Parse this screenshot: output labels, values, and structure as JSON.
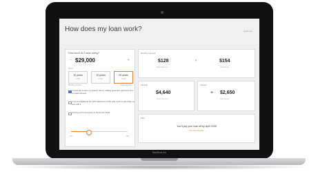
{
  "device": {
    "brand": "MacBook Air"
  },
  "page": {
    "title": "How does my loan work?",
    "top_link": "@earnest"
  },
  "left_panel": {
    "question": "How much do I have owing?",
    "amount": "$29,000",
    "minus": "−",
    "plus": "+",
    "term_label": "Term",
    "terms": [
      {
        "years": "10 years",
        "rate": "3.6%"
      },
      {
        "years": "15 years",
        "rate": "3.9%"
      },
      {
        "years": "20 years",
        "rate": "4.2%"
      }
    ],
    "subs": [
      "Monthly payment",
      "Total payment"
    ],
    "options": [
      "I would like to save my interest rate by making automatic payments from my bank account",
      "I may be eligible for the 10% federal tax credit, and I want to pay down my loan with it",
      "Coming of the loan/grace in December 2018"
    ],
    "slider_min": "1%",
    "slider_max": "8%",
    "slider_value": 0.3
  },
  "cards": {
    "monthly": {
      "label": "Monthly payment",
      "from_value": "$128",
      "from_caption": "before Earnest",
      "to_value": "$154",
      "to_caption": "with Earnest",
      "arrow": "›",
      "to_icon": "↑"
    },
    "savings": {
      "label": "Savings",
      "value": "$4,640",
      "caption": "saved over term"
    },
    "interest": {
      "label": "Interest",
      "sign": "+",
      "value": "$2,650",
      "caption": "total interest"
    },
    "plan": {
      "label": "Plan",
      "text": "You'll pay your loan off by April 2028",
      "link": "See full schedule"
    }
  }
}
